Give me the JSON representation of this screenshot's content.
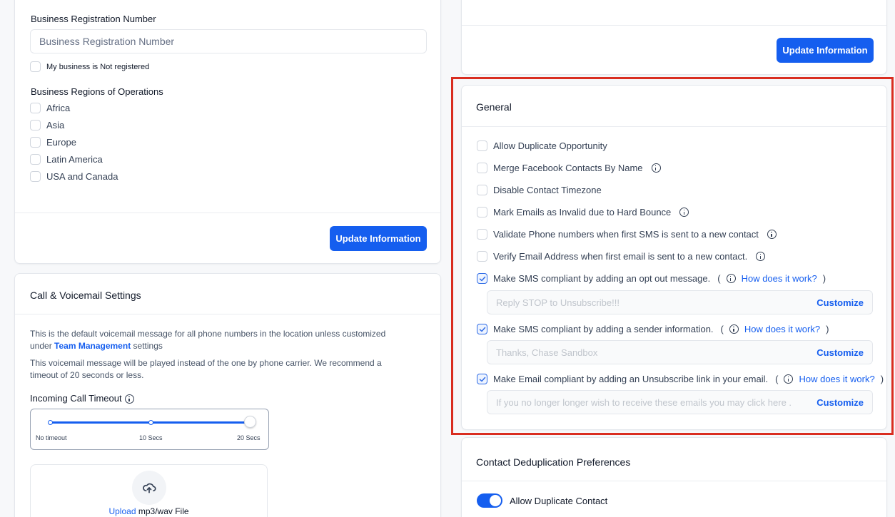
{
  "business": {
    "reg_label": "Business Registration Number",
    "reg_placeholder": "Business Registration Number",
    "not_registered": "My business is Not registered",
    "regions_label": "Business Regions of Operations",
    "regions": [
      "Africa",
      "Asia",
      "Europe",
      "Latin America",
      "USA and Canada"
    ],
    "update_label": "Update Information"
  },
  "top_right": {
    "update_label": "Update Information"
  },
  "call": {
    "title": "Call & Voicemail Settings",
    "desc1_a": "This is the default voicemail message for all phone numbers in the location unless customized",
    "desc1_b": "under",
    "desc1_link": "Team Management",
    "desc1_c": "settings",
    "desc2_a": "This voicemail message will be played instead of the one by phone carrier. We recommend a",
    "desc2_b": "timeout of 20 seconds or less.",
    "timeout_label": "Incoming Call Timeout",
    "slider_labels": [
      "No timeout",
      "10 Secs",
      "20 Secs"
    ],
    "slider_value": "20 Secs",
    "upload_link": "Upload",
    "upload_text": "mp3/wav File"
  },
  "general": {
    "title": "General",
    "options": [
      {
        "label": "Allow Duplicate Opportunity",
        "checked": false,
        "info": false
      },
      {
        "label": "Merge Facebook Contacts By Name",
        "checked": false,
        "info": true
      },
      {
        "label": "Disable Contact Timezone",
        "checked": false,
        "info": false
      },
      {
        "label": "Mark Emails as Invalid due to Hard Bounce",
        "checked": false,
        "info": true
      },
      {
        "label": "Validate Phone numbers when first SMS is sent to a new contact",
        "checked": false,
        "info": true
      },
      {
        "label": "Verify Email Address when first email is sent to a new contact.",
        "checked": false,
        "info": true
      }
    ],
    "sms_optout": {
      "label": "Make SMS compliant by adding an opt out message.",
      "checked": true,
      "how": "How does it work?",
      "placeholder": "Reply STOP to Unsubscribe!!!",
      "customize": "Customize"
    },
    "sms_sender": {
      "label": "Make SMS compliant by adding a sender information.",
      "checked": true,
      "how": "How does it work?",
      "placeholder": "Thanks, Chase Sandbox",
      "customize": "Customize"
    },
    "email_unsub": {
      "label": "Make Email compliant by adding an Unsubscribe link in your email.",
      "checked": true,
      "how": "How does it work?",
      "placeholder": "If you no longer longer wish to receive these emails you may click here .",
      "customize": "Customize"
    }
  },
  "dedupe": {
    "title": "Contact Deduplication Preferences",
    "toggle_label": "Allow Duplicate Contact",
    "toggle_on": true
  },
  "colors": {
    "accent": "#155eef",
    "highlight": "#d92d20"
  }
}
